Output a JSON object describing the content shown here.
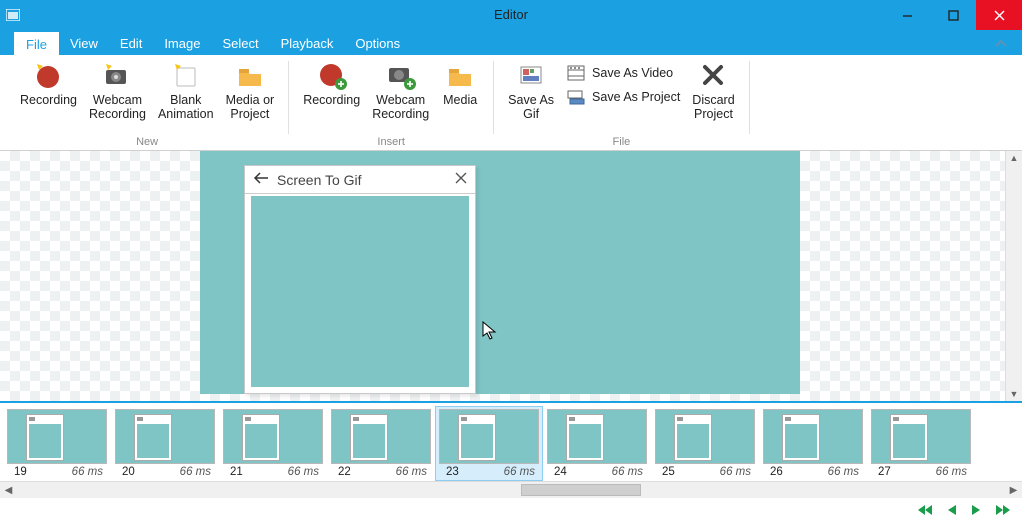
{
  "window": {
    "title": "Editor"
  },
  "tabs": [
    "File",
    "View",
    "Edit",
    "Image",
    "Select",
    "Playback",
    "Options"
  ],
  "activeTab": 0,
  "ribbon": {
    "groups": {
      "new": {
        "label": "New",
        "recording": "Recording",
        "webcam1": "Webcam",
        "webcam2": "Recording",
        "blank1": "Blank",
        "blank2": "Animation",
        "media1": "Media or",
        "media2": "Project"
      },
      "insert": {
        "label": "Insert",
        "recording": "Recording",
        "webcam1": "Webcam",
        "webcam2": "Recording",
        "media": "Media"
      },
      "file": {
        "label": "File",
        "saveGif1": "Save As",
        "saveGif2": "Gif",
        "saveVideo": "Save As Video",
        "saveProject": "Save As Project",
        "discard1": "Discard",
        "discard2": "Project"
      }
    }
  },
  "innerWindow": {
    "title": "Screen To Gif"
  },
  "frames": [
    {
      "num": "19",
      "dur": "66 ms"
    },
    {
      "num": "20",
      "dur": "66 ms"
    },
    {
      "num": "21",
      "dur": "66 ms"
    },
    {
      "num": "22",
      "dur": "66 ms"
    },
    {
      "num": "23",
      "dur": "66 ms"
    },
    {
      "num": "24",
      "dur": "66 ms"
    },
    {
      "num": "25",
      "dur": "66 ms"
    },
    {
      "num": "26",
      "dur": "66 ms"
    },
    {
      "num": "27",
      "dur": "66 ms"
    }
  ],
  "selectedFrame": 4
}
